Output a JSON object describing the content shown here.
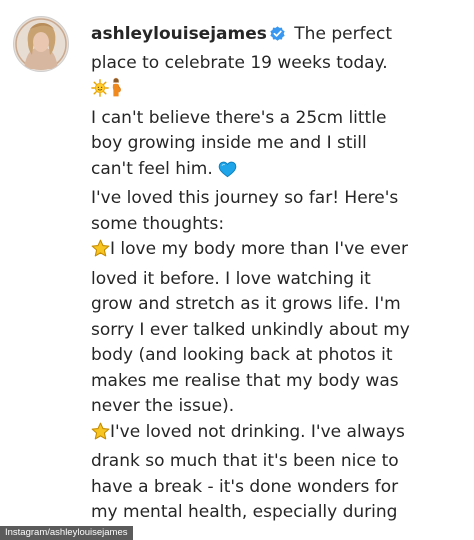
{
  "post": {
    "username": "ashleylouisejames",
    "caption_lines": [
      "The perfect",
      "place to celebrate 19 weeks today.",
      "I can't believe there's a 25cm little",
      "boy growing inside me and I still",
      "can't feel him.",
      "I've loved this journey so far! Here's",
      "some thoughts:",
      "I love my body more than I've ever",
      "loved it before. I love watching it",
      "grow and stretch as it grows life. I'm",
      "sorry I ever talked unkindly about my",
      "body (and looking back at photos it",
      "makes me realise that my body was",
      "never the issue).",
      "I've loved not drinking. I've always",
      "drank so much that it's been nice to",
      "have a break - it's done wonders for",
      "my mental health, especially during"
    ],
    "icons": {
      "verified": "verified-badge-icon",
      "sun": "sun-emoji-icon",
      "pregnant": "pregnant-woman-emoji-icon",
      "heart": "blue-heart-emoji-icon",
      "star": "star-emoji-icon"
    },
    "colors": {
      "text": "#262626",
      "verified_blue": "#3897f0",
      "heart_blue": "#1ea5e9",
      "star_yellow": "#f7c521"
    }
  },
  "credit": "Instagram/ashleylouisejames"
}
